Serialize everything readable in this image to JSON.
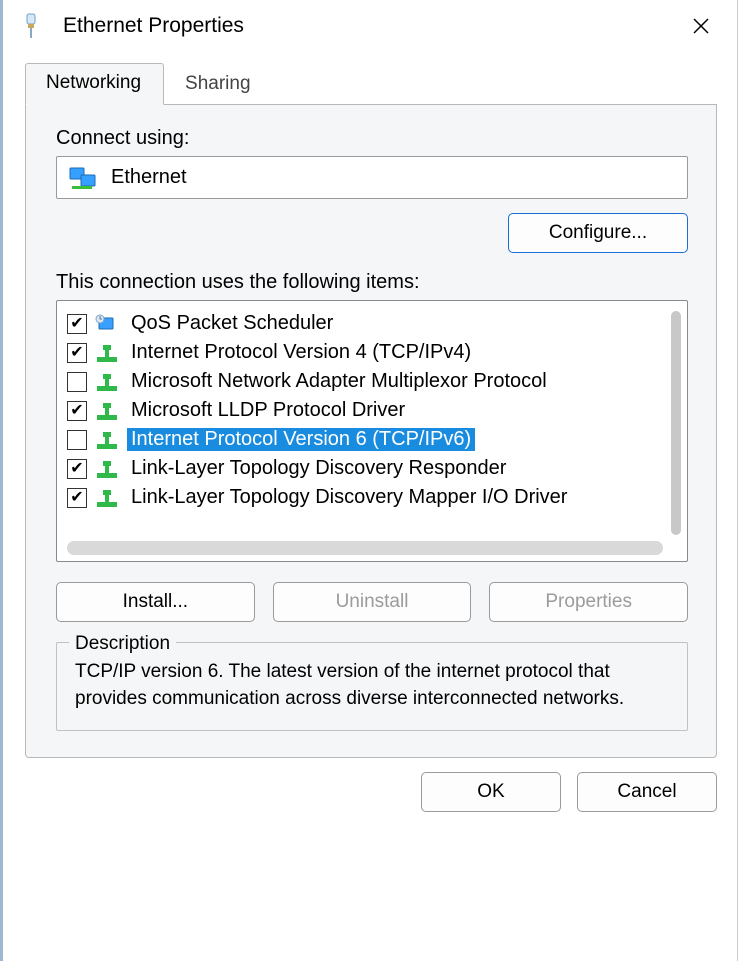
{
  "window": {
    "title": "Ethernet Properties"
  },
  "tabs": [
    {
      "label": "Networking",
      "active": true
    },
    {
      "label": "Sharing",
      "active": false
    }
  ],
  "connect": {
    "label": "Connect using:",
    "adapter_name": "Ethernet",
    "configure_button": "Configure..."
  },
  "items_label": "This connection uses the following items:",
  "items": [
    {
      "checked": true,
      "icon": "qos-icon",
      "label": "QoS Packet Scheduler",
      "selected": false
    },
    {
      "checked": true,
      "icon": "protocol-icon",
      "label": "Internet Protocol Version 4 (TCP/IPv4)",
      "selected": false
    },
    {
      "checked": false,
      "icon": "protocol-icon",
      "label": "Microsoft Network Adapter Multiplexor Protocol",
      "selected": false
    },
    {
      "checked": true,
      "icon": "protocol-icon",
      "label": "Microsoft LLDP Protocol Driver",
      "selected": false
    },
    {
      "checked": false,
      "icon": "protocol-icon",
      "label": "Internet Protocol Version 6 (TCP/IPv6)",
      "selected": true
    },
    {
      "checked": true,
      "icon": "protocol-icon",
      "label": "Link-Layer Topology Discovery Responder",
      "selected": false
    },
    {
      "checked": true,
      "icon": "protocol-icon",
      "label": "Link-Layer Topology Discovery Mapper I/O Driver",
      "selected": false
    }
  ],
  "buttons": {
    "install": "Install...",
    "uninstall": "Uninstall",
    "properties": "Properties"
  },
  "description": {
    "legend": "Description",
    "text": "TCP/IP version 6. The latest version of the internet protocol that provides communication across diverse interconnected networks."
  },
  "footer": {
    "ok": "OK",
    "cancel": "Cancel"
  }
}
